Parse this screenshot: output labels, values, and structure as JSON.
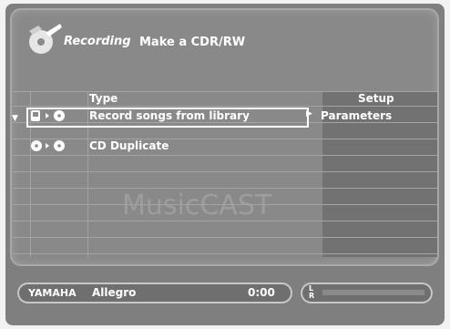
{
  "header": {
    "title": "Recording",
    "subtitle": "Make a CDR/RW",
    "icon": "recording-cd-icon"
  },
  "table": {
    "columns": {
      "type": "Type",
      "setup": "Setup"
    },
    "rows": [
      {
        "label": "Record songs from library",
        "icon": "library-to-cd-icon",
        "selected": true,
        "setup": "Parameters"
      },
      {
        "label": "CD Duplicate",
        "icon": "cd-to-cd-icon",
        "selected": false
      }
    ]
  },
  "watermark": "MusicCAST",
  "status": {
    "brand": "YAMAHA",
    "album": "Allegro",
    "time": "0:00",
    "level_label": "L\nR"
  },
  "colors": {
    "panel": "#898989",
    "highlight": "#ffffff",
    "text": "#ffffff"
  }
}
